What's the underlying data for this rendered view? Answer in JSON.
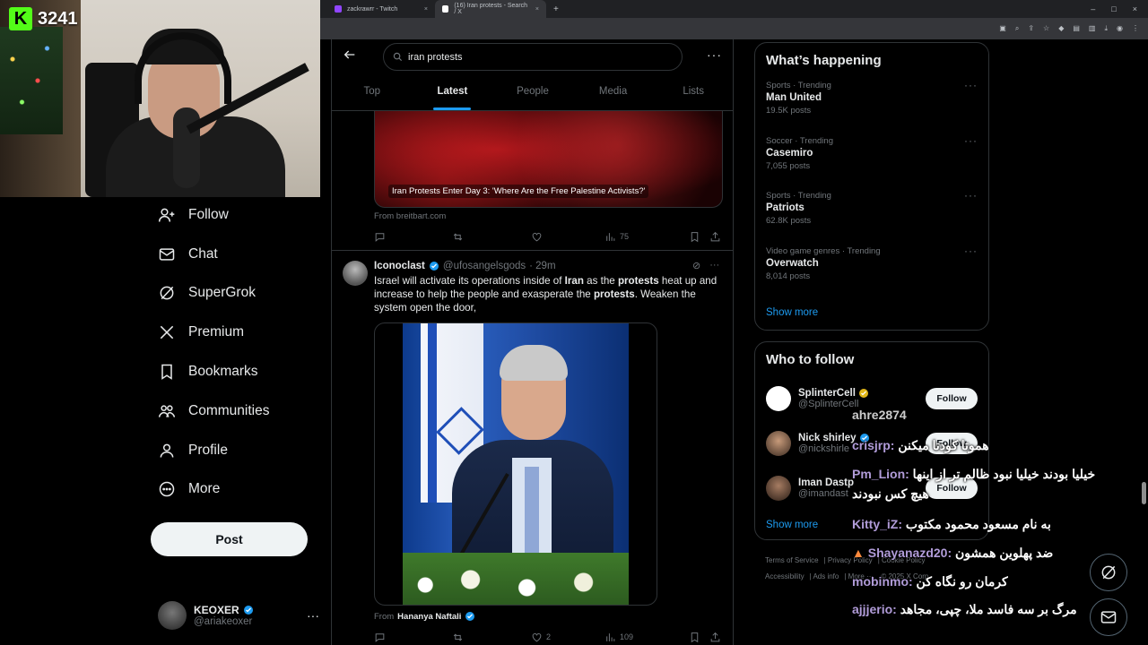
{
  "stream": {
    "viewer_count": "3241"
  },
  "browser": {
    "tabs": [
      {
        "title": "zackrawrr - Twitch"
      },
      {
        "title": "(16) Iran protests - Search / X"
      }
    ]
  },
  "nav": {
    "items": [
      {
        "label": "Follow",
        "icon": "add-person-icon"
      },
      {
        "label": "Chat",
        "icon": "envelope-icon"
      },
      {
        "label": "SuperGrok",
        "icon": "grok-icon"
      },
      {
        "label": "Premium",
        "icon": "x-logo-icon"
      },
      {
        "label": "Bookmarks",
        "icon": "bookmark-icon"
      },
      {
        "label": "Communities",
        "icon": "communities-icon"
      },
      {
        "label": "Profile",
        "icon": "person-icon"
      },
      {
        "label": "More",
        "icon": "more-circle-icon"
      }
    ],
    "post_label": "Post",
    "account": {
      "name": "KEOXER",
      "handle": "@ariakeoxer"
    }
  },
  "search": {
    "query": "iran protests",
    "tabs": [
      "Top",
      "Latest",
      "People",
      "Media",
      "Lists"
    ],
    "active_tab": "Latest"
  },
  "feed": {
    "card1": {
      "caption": "Iran Protests Enter Day 3: 'Where Are the Free Palestine Activists?'",
      "from": "From breitbart.com",
      "views": "75"
    },
    "tweet": {
      "name": "Iconoclast",
      "handle": "@ufosangelsgods",
      "time": "· 29m",
      "text_parts": [
        "Israel will activate its operations inside of ",
        "Iran",
        " as the ",
        "protests",
        " heat up and increase to help the people and exasperate the ",
        "protests",
        ". Weaken the system open the door,"
      ],
      "from_prefix": "From",
      "from_name": "Hananya Naftali",
      "likes": "2",
      "views": "109"
    }
  },
  "sidebar": {
    "happening_title": "What’s happening",
    "trends": [
      {
        "category": "Sports · Trending",
        "title": "Man United",
        "count": "19.5K posts"
      },
      {
        "category": "Soccer · Trending",
        "title": "Casemiro",
        "count": "7,055 posts"
      },
      {
        "category": "Sports · Trending",
        "title": "Patriots",
        "count": "62.8K posts"
      },
      {
        "category": "Video game genres · Trending",
        "title": "Overwatch",
        "count": "8,014 posts"
      }
    ],
    "show_more": "Show more",
    "who_title": "Who to follow",
    "who": [
      {
        "name": "SplinterCell",
        "handle": "@SplinterCell",
        "follow": "Follow"
      },
      {
        "name": "Nick shirley",
        "handle": "@nickshirle",
        "follow": "Follow"
      },
      {
        "name": "Iman Dastp",
        "handle": "@imandast",
        "follow": "Follow"
      }
    ],
    "who_show_more": "Show more",
    "footer": [
      "Terms of Service",
      "Privacy Policy",
      "Cookie Policy",
      "Accessibility",
      "Ads info",
      "More ···",
      "© 2025 X Corp."
    ]
  },
  "chat": [
    {
      "user": "",
      "text": "ahre2874"
    },
    {
      "user": "crisjrp:",
      "text": "هموتا کودتا میکنن"
    },
    {
      "user": "Pm_Lion:",
      "text": "خیلیا بودند خیلیا نبود ظالم تر از اینها"
    },
    {
      "user": "",
      "text": "هیچ کس نبودند"
    },
    {
      "user": "Kitty_iZ:",
      "text": "به نام مسعود محمود مکتوب"
    },
    {
      "user": "Shayanazd20:",
      "text": "ضد پهلوین همشون"
    },
    {
      "user": "mobinmo:",
      "text": "کرمان رو نگاه کن"
    },
    {
      "user": "ajjjerio:",
      "text": "مرگ بر سه فاسد ملا، چپی، مجاهد"
    }
  ],
  "colors": {
    "accent": "#1d9bf0",
    "kick_green": "#53fc18",
    "chat_user": "#b19cd9"
  }
}
